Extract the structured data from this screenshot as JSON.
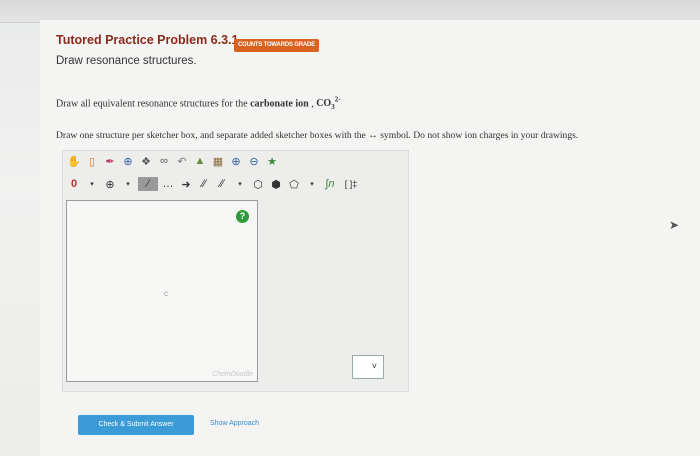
{
  "header": {
    "title": "Tutored Practice Problem 6.3.1",
    "badge": "COUNTS TOWARDS GRADE",
    "subtitle": "Draw resonance structures."
  },
  "question": {
    "line1_prefix": "Draw all equivalent resonance structures for the",
    "line1_bold": "carbonate ion",
    "line1_comma": " ,",
    "formula": "CO",
    "formula_sub": "3",
    "formula_sup": "2-",
    "line2": "Draw one structure per sketcher box, and separate added sketcher boxes with the ↔ symbol. Do not show ion charges in your drawings."
  },
  "sketcher": {
    "canvas_label": "c",
    "brand": "ChemDoodle",
    "help": "?",
    "toolbar_row1": [
      "hand-icon",
      "eraser-icon",
      "pen-icon",
      "move-icon",
      "zoom-fit-icon",
      "chain-icon",
      "lasso-icon",
      "template-icon",
      "clipboard-icon",
      "zoom-in-icon",
      "zoom-out-icon",
      "clean-icon"
    ],
    "toolbar_row2_labels": [
      "0",
      "⊕"
    ],
    "toolbar_row2_end": "[ ]‡"
  },
  "controls": {
    "select_arrow": "˅",
    "check_button": "Check & Submit Answer",
    "show_approach": "Show Approach"
  },
  "colors": {
    "title": "#8a2a1a",
    "badge": "#d9621e",
    "button": "#3a9bd6",
    "help": "#2f9a3a"
  }
}
